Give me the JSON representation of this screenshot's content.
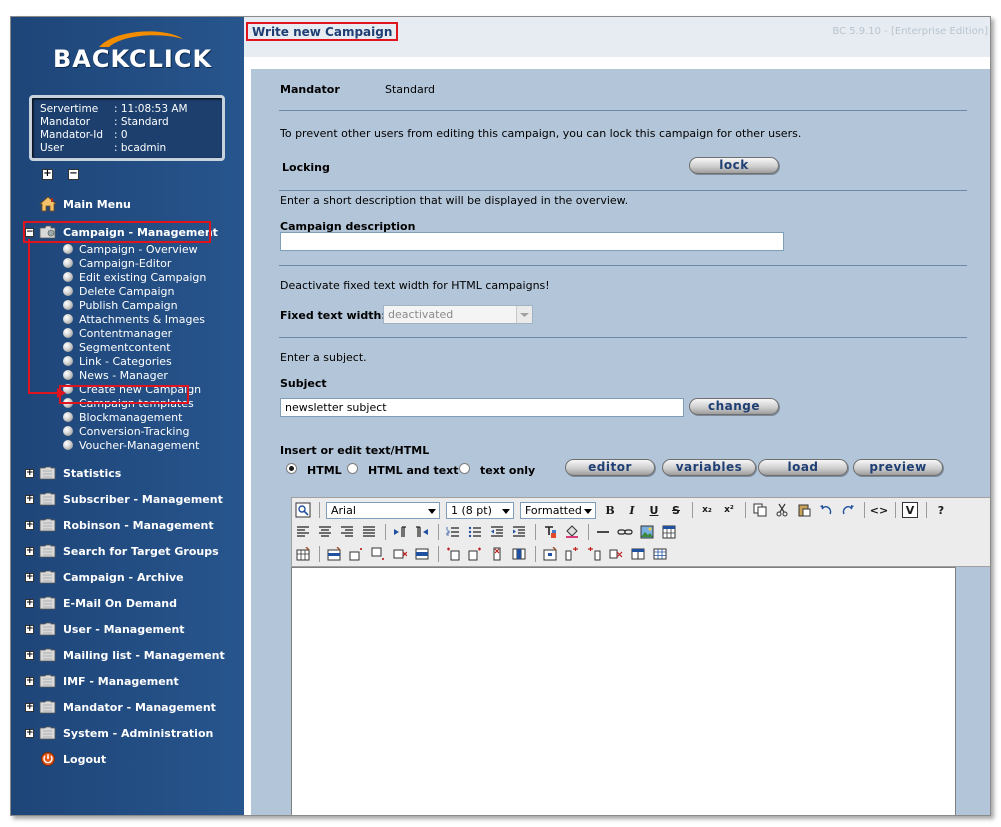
{
  "logo": {
    "text": "BACKCLICK"
  },
  "server_info": [
    {
      "key": "Servertime",
      "value": ": 11:08:53 AM"
    },
    {
      "key": "Mandator",
      "value": ": Standard"
    },
    {
      "key": "Mandator-Id",
      "value": ": 0"
    },
    {
      "key": "User",
      "value": ": bcadmin"
    }
  ],
  "tree_controls": {
    "expand": "+",
    "collapse": "−"
  },
  "nav": {
    "main_menu": "Main Menu",
    "campaign_management": "Campaign - Management",
    "campaign_sub": [
      "Campaign - Overview",
      "Campaign-Editor",
      "Edit existing Campaign",
      "Delete Campaign",
      "Publish Campaign",
      "Attachments & Images",
      "Contentmanager",
      "Segmentcontent",
      "Link - Categories",
      "News - Manager",
      "Create new Campaign",
      "Campaign templates",
      "Blockmanagement",
      "Conversion-Tracking",
      "Voucher-Management"
    ],
    "sections": [
      "Statistics",
      "Subscriber - Management",
      "Robinson - Management",
      "Search for Target Groups",
      "Campaign - Archive",
      "E-Mail On Demand",
      "User - Management",
      "Mailing list - Management",
      "IMF - Management",
      "Mandator - Management",
      "System - Administration"
    ],
    "logout": "Logout"
  },
  "header": {
    "title": "Write new Campaign",
    "version": "BC 5.9.10 - [Enterprise Edition]"
  },
  "form": {
    "mandator_label": "Mandator",
    "mandator_value": "Standard",
    "lock_hint": "To prevent other users from editing this campaign, you can lock this campaign for other users.",
    "locking_label": "Locking",
    "lock_button": "lock",
    "desc_hint": "Enter a short description that will be displayed in the overview.",
    "desc_label": "Campaign description",
    "desc_value": "",
    "width_hint": "Deactivate fixed text width for HTML campaigns!",
    "width_label": "Fixed text width:",
    "width_value": "deactivated",
    "subject_hint": "Enter a subject.",
    "subject_label": "Subject",
    "subject_value": "newsletter subject",
    "change_button": "change",
    "editor_label": "Insert or edit text/HTML",
    "radio_options": [
      "HTML",
      "HTML and text",
      "text only"
    ],
    "radio_selected": "HTML",
    "editor_buttons": [
      "editor",
      "variables",
      "load",
      "preview"
    ]
  },
  "toolbar": {
    "font": "Arial",
    "size": "1 (8 pt)",
    "format": "Formatted",
    "bold": "B",
    "italic": "I",
    "underline": "U",
    "strike": "S",
    "subscript": "x₂",
    "superscript": "x²",
    "source": "<>",
    "variable": "V",
    "help": "?"
  },
  "colors": {
    "sidebar": "#27558d",
    "main": "#b3c5d8",
    "highlight": "#e0141e",
    "title": "#1f3f74"
  }
}
